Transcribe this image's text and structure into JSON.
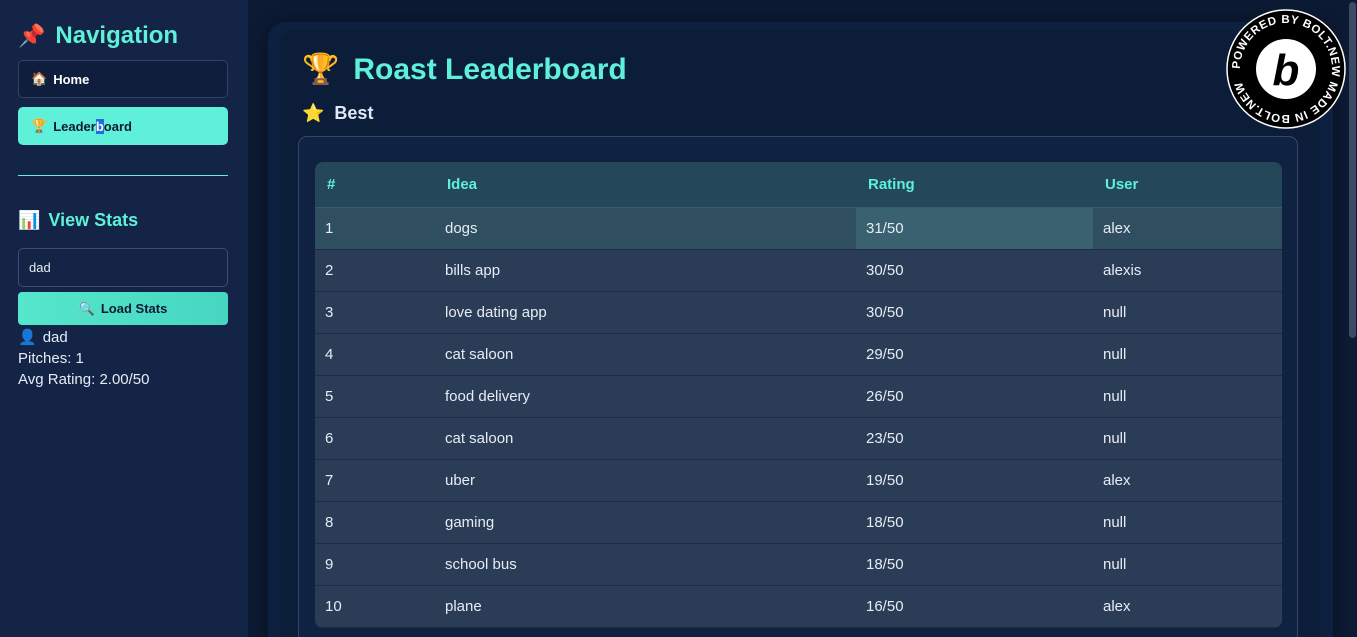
{
  "sidebar": {
    "nav_title": "Navigation",
    "nav_emoji": "📌",
    "home_label": "Home",
    "home_emoji": "🏠",
    "leaderboard_emoji": "🏆",
    "leaderboard_label_a": "Leader",
    "leaderboard_label_b": "b",
    "leaderboard_label_c": "oard",
    "stats_title": "View Stats",
    "stats_emoji": "📊",
    "search_value": "dad",
    "load_label": "Load Stats",
    "load_emoji": "🔍",
    "user_emoji": "👤",
    "user_name": "dad",
    "pitches": "Pitches: 1",
    "avg_rating": "Avg Rating: 2.00/50"
  },
  "main": {
    "title_emoji": "🏆",
    "title": "Roast Leaderboard",
    "section_emoji": "⭐",
    "section": "Best",
    "columns": [
      "#",
      "Idea",
      "Rating",
      "User"
    ],
    "rows": [
      {
        "rank": "1",
        "idea": "dogs",
        "rating": "31/50",
        "user": "alex"
      },
      {
        "rank": "2",
        "idea": "bills app",
        "rating": "30/50",
        "user": "alexis"
      },
      {
        "rank": "3",
        "idea": "love dating app",
        "rating": "30/50",
        "user": "null"
      },
      {
        "rank": "4",
        "idea": "cat saloon",
        "rating": "29/50",
        "user": "null"
      },
      {
        "rank": "5",
        "idea": "food delivery",
        "rating": "26/50",
        "user": "null"
      },
      {
        "rank": "6",
        "idea": "cat saloon",
        "rating": "23/50",
        "user": "null"
      },
      {
        "rank": "7",
        "idea": "uber",
        "rating": "19/50",
        "user": "alex"
      },
      {
        "rank": "8",
        "idea": "gaming",
        "rating": "18/50",
        "user": "null"
      },
      {
        "rank": "9",
        "idea": "school bus",
        "rating": "18/50",
        "user": "null"
      },
      {
        "rank": "10",
        "idea": "plane",
        "rating": "16/50",
        "user": "alex"
      }
    ]
  },
  "badge": {
    "ring_text": "POWERED BY BOLT.NEW MADE IN BOLT.NEW ",
    "letter": "b"
  }
}
